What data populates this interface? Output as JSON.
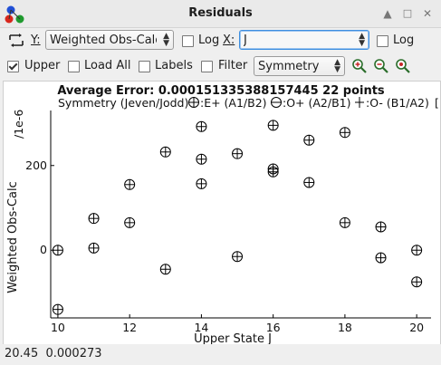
{
  "window": {
    "title": "Residuals"
  },
  "toolbar1": {
    "y_label": "Y:",
    "y_select": "Weighted Obs-Calc",
    "log_y_label": "Log",
    "x_label": "X:",
    "x_select": "J",
    "log_x_label": "Log"
  },
  "toolbar2": {
    "upper_label": "Upper",
    "load_all_label": "Load All",
    "labels_label": "Labels",
    "filter_label": "Filter",
    "filter_select": "Symmetry"
  },
  "plot": {
    "header": "Average Error: 0.000151335388157445  22 points",
    "legend": {
      "prefix": "Symmetry (Jeven/Jodd)",
      "items": [
        {
          "symbol": "plus-circle",
          "text": ":E+ (A1/B2)"
        },
        {
          "symbol": "minus-circle",
          "text": ":O+ (A2/B1)"
        },
        {
          "symbol": "plus",
          "text": ":O- (B1/A2)"
        }
      ],
      "suffix": "["
    },
    "y_scale_label": "/1e-6",
    "y_axis_label": "Weighted Obs-Calc",
    "x_axis_label": "Upper State J"
  },
  "chart_data": {
    "type": "scatter",
    "xlabel": "Upper State J",
    "ylabel": "Weighted Obs-Calc",
    "xlim": [
      9.8,
      20.4
    ],
    "ylim": [
      -160,
      330
    ],
    "x_ticks": [
      "10",
      "12",
      "14",
      "16",
      "18",
      "20"
    ],
    "y_ticks": [
      "0",
      "200"
    ],
    "series": [
      {
        "name": ":E+ (A1/B2)",
        "points": [
          [
            10,
            -140
          ],
          [
            10,
            0
          ],
          [
            11,
            75
          ],
          [
            11,
            5
          ],
          [
            12,
            155
          ],
          [
            12,
            65
          ],
          [
            13,
            232
          ],
          [
            13,
            -45
          ],
          [
            14,
            292
          ],
          [
            14,
            215
          ],
          [
            14,
            157
          ],
          [
            15,
            228
          ],
          [
            15,
            -15
          ],
          [
            16,
            192
          ],
          [
            16,
            185
          ],
          [
            16,
            295
          ],
          [
            17,
            260
          ],
          [
            17,
            160
          ],
          [
            18,
            278
          ],
          [
            18,
            65
          ],
          [
            19,
            55
          ],
          [
            19,
            -18
          ],
          [
            20,
            0
          ],
          [
            20,
            -75
          ]
        ]
      }
    ]
  },
  "status": {
    "cursor_x": "20.45",
    "cursor_y": "0.000273"
  }
}
